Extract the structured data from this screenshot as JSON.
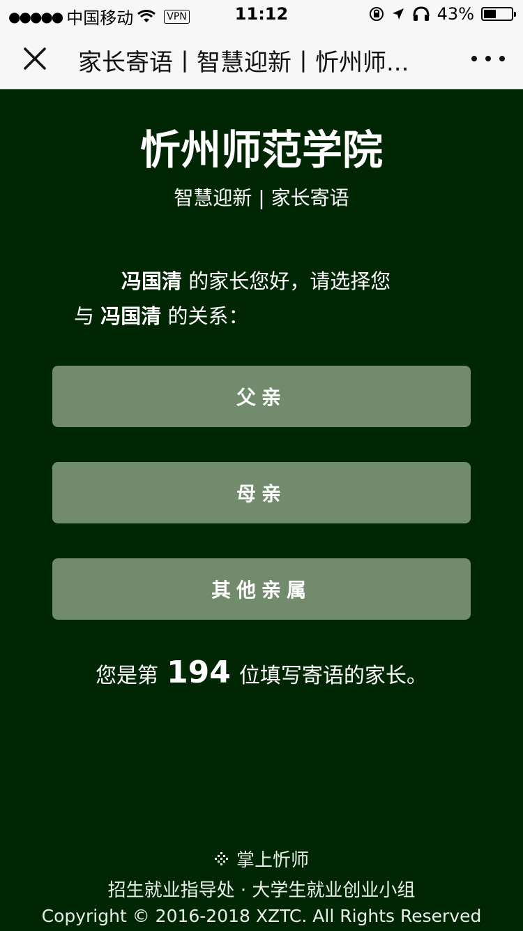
{
  "status_bar": {
    "carrier": "中国移动",
    "vpn": "VPN",
    "time": "11:12",
    "battery": "43%"
  },
  "nav": {
    "title": "家长寄语丨智慧迎新丨忻州师..."
  },
  "page": {
    "school_name": "忻州师范学院",
    "subtitle": "智慧迎新 | 家长寄语",
    "student_name": "冯国清",
    "greeting_part1": " 的家长您好，请选择您",
    "greeting_part2_prefix": "与 ",
    "greeting_part2_suffix": " 的关系："
  },
  "buttons": {
    "father": "父亲",
    "mother": "母亲",
    "other": "其他亲属"
  },
  "counter": {
    "prefix": "您是第",
    "number": "194",
    "suffix": "位填写寄语的家长。"
  },
  "footer": {
    "brand": "掌上忻师",
    "org": "招生就业指导处 · 大学生就业创业小组",
    "copyright": "Copyright © 2016-2018 XZTC. All Rights Reserved"
  },
  "colors": {
    "background": "#002604",
    "button": "#728b6d"
  }
}
